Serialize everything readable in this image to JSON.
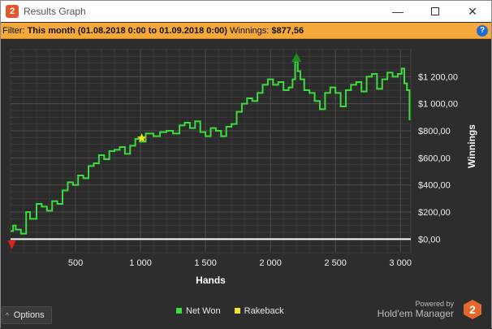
{
  "window": {
    "title": "Results Graph",
    "minimize_symbol": "—",
    "close_symbol": "✕"
  },
  "filter": {
    "prefix": "Filter:",
    "range": "This month (01.08.2018 0:00 to 01.09.2018 0:00)",
    "winnings_label": "Winnings:",
    "winnings_value": "$877,56",
    "help_symbol": "?"
  },
  "chart_data": {
    "type": "line",
    "xlabel": "Hands",
    "ylabel": "Winnings",
    "xlim": [
      0,
      3080
    ],
    "ylim": [
      -100,
      1400
    ],
    "x_ticks": [
      500,
      1000,
      1500,
      2000,
      2500,
      3000
    ],
    "x_tick_labels": [
      "500",
      "1 000",
      "1 500",
      "2 000",
      "2 500",
      "3 000"
    ],
    "y_ticks": [
      0,
      200,
      400,
      600,
      800,
      1000,
      1200
    ],
    "y_tick_labels": [
      "$0,00",
      "$200,00",
      "$400,00",
      "$600,00",
      "$800,00",
      "$1 000,00",
      "$1 200,00"
    ],
    "zero_line": true,
    "series": [
      {
        "name": "Net Won",
        "color": "#3ddc3d",
        "x": [
          0,
          20,
          40,
          80,
          120,
          150,
          200,
          240,
          280,
          320,
          360,
          400,
          440,
          480,
          520,
          560,
          600,
          640,
          680,
          720,
          760,
          800,
          840,
          880,
          920,
          960,
          1000,
          1040,
          1100,
          1150,
          1200,
          1250,
          1300,
          1340,
          1380,
          1420,
          1460,
          1500,
          1540,
          1580,
          1620,
          1660,
          1700,
          1740,
          1780,
          1820,
          1860,
          1900,
          1940,
          1980,
          2020,
          2060,
          2100,
          2140,
          2170,
          2190,
          2210,
          2230,
          2260,
          2300,
          2340,
          2380,
          2420,
          2460,
          2500,
          2540,
          2580,
          2620,
          2660,
          2700,
          2740,
          2780,
          2820,
          2860,
          2900,
          2940,
          2980,
          3010,
          3030,
          3050,
          3070
        ],
        "y": [
          60,
          100,
          70,
          40,
          200,
          150,
          260,
          240,
          210,
          280,
          260,
          360,
          420,
          400,
          470,
          450,
          540,
          560,
          620,
          590,
          650,
          660,
          680,
          630,
          690,
          740,
          720,
          780,
          760,
          790,
          800,
          780,
          840,
          860,
          820,
          870,
          790,
          760,
          820,
          800,
          760,
          830,
          850,
          940,
          1000,
          1040,
          1020,
          1080,
          1140,
          1180,
          1140,
          1160,
          1100,
          1120,
          1180,
          1310,
          1240,
          1180,
          1100,
          1080,
          1020,
          960,
          1080,
          1120,
          1080,
          980,
          1100,
          1140,
          1160,
          1090,
          1200,
          1220,
          1110,
          1180,
          1230,
          1200,
          1220,
          1260,
          1150,
          1100,
          877.56
        ]
      }
    ],
    "markers": [
      {
        "type": "rakeback",
        "color": "#f2e42b",
        "x": 1010,
        "y": 745
      },
      {
        "type": "high",
        "color": "#1f8a1f",
        "x": 2200,
        "y": 1340
      },
      {
        "type": "low",
        "color": "#e02020",
        "x": 10,
        "y": -40
      }
    ],
    "legend": [
      {
        "label": "Net Won",
        "color": "#3ddc3d"
      },
      {
        "label": "Rakeback",
        "color": "#f2e42b"
      }
    ],
    "legend_position": "bottom-center",
    "grid": true
  },
  "statusbar": {
    "options_label": "Options",
    "options_caret": "^",
    "powered_by": "Powered by",
    "brand": "Hold'em Manager",
    "brand_logo_text": "2"
  }
}
